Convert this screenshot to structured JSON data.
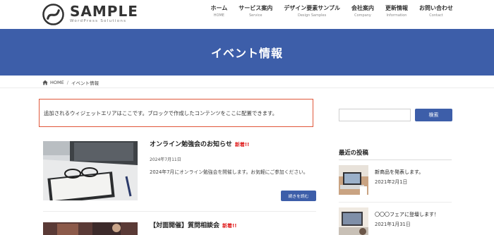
{
  "site": {
    "logo_title": "SAMPLE",
    "logo_subtitle": "WordPress Solutions"
  },
  "nav": {
    "items": [
      {
        "jp": "ホーム",
        "en": "HOME"
      },
      {
        "jp": "サービス案内",
        "en": "Service"
      },
      {
        "jp": "デザイン要素サンプル",
        "en": "Design Samples"
      },
      {
        "jp": "会社案内",
        "en": "Company"
      },
      {
        "jp": "更新情報",
        "en": "Information"
      },
      {
        "jp": "お問い合わせ",
        "en": "Contact"
      }
    ]
  },
  "hero": {
    "title": "イベント情報"
  },
  "breadcrumb": {
    "home": "HOME",
    "separator": "/",
    "current": "イベント情報"
  },
  "widget_notice": "追加されるウィジェットエリアはここです。ブロックで作成したコンテンツをここに配置できます。",
  "posts": [
    {
      "title": "オンライン勉強会のお知らせ",
      "badge": "新着!!",
      "date": "2024年7月11日",
      "excerpt": "2024年7月にオンライン勉強会を開催します。お気軽にご参加ください。",
      "read_more": "続きを読む"
    },
    {
      "title": "【対面開催】質問相談会",
      "badge": "新着!!"
    }
  ],
  "sidebar": {
    "search_button": "検索",
    "search_placeholder": "",
    "recent_heading": "最近の投稿",
    "recent": [
      {
        "title": "新商品を発表します。",
        "date": "2021年2月1日"
      },
      {
        "title": "〇〇〇フェアに登壇します！",
        "date": "2021年1月31日"
      }
    ]
  },
  "colors": {
    "brand": "#3d5ea9",
    "new_badge": "#e02020",
    "widget_border": "#e0573a"
  }
}
